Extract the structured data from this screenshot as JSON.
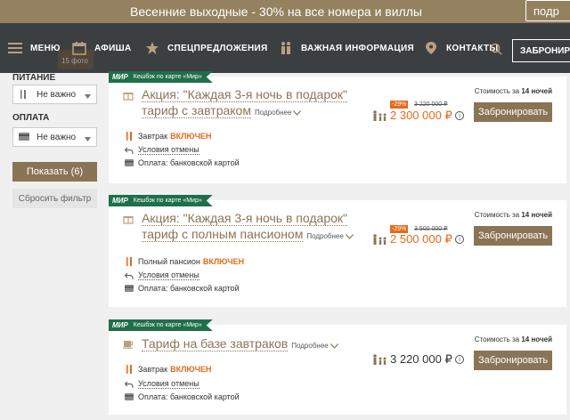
{
  "promo": {
    "text": "Весенние выходные - 30% на все номера и виллы",
    "button": "подр"
  },
  "nav": {
    "menu": "МЕНЮ",
    "items": [
      "АФИША",
      "СПЕЦПРЕДЛОЖЕНИЯ",
      "ВАЖНАЯ ИНФОРМАЦИЯ",
      "КОНТАКТЫ"
    ],
    "book": "ЗАБРОНИР",
    "photo_count": "15 фото"
  },
  "filters": {
    "food_label": "ПИТАНИЕ",
    "food_value": "Не важно",
    "payment_label": "ОПЛАТА",
    "payment_value": "Не важно",
    "show_button": "Показать (6)",
    "reset_button": "Сбросить фильтр"
  },
  "common": {
    "badge_mir": "МИР",
    "badge_text": "Кешбэк по карте «Мир»",
    "cost_prefix": "Стоимость за",
    "cost_nights": "14 ночей",
    "book_button": "Забронировать",
    "more": "Подробнее",
    "cancel": "Условия отмены",
    "payment": "Оплата: банковской картой",
    "included": "ВКЛЮЧЕН",
    "info": "i"
  },
  "offers": [
    {
      "title_line1": "Акция: \"Каждая 3-я ночь в подарок\"",
      "title_line2": "тариф с завтраком",
      "discount": "-29%",
      "old_price": "3 220 000 ₽",
      "price": "2 300 000 ₽",
      "meal": "Завтрак"
    },
    {
      "title_line1": "Акция: \"Каждая 3-я ночь в подарок\"",
      "title_line2": "тариф с полным пансионом",
      "discount": "-29%",
      "old_price": "3 500 000 ₽",
      "price": "2 500 000 ₽",
      "meal": "Полный пансион"
    },
    {
      "title_line1": "Тариф на базе завтраков",
      "price": "3 220 000 ₽",
      "meal": "Завтрак"
    }
  ],
  "colors": {
    "accent": "#8a7456",
    "promo": "#93815f",
    "nav": "#3c3f42",
    "sale": "#e36b1b",
    "mir_badge": "#1f6f4a"
  }
}
